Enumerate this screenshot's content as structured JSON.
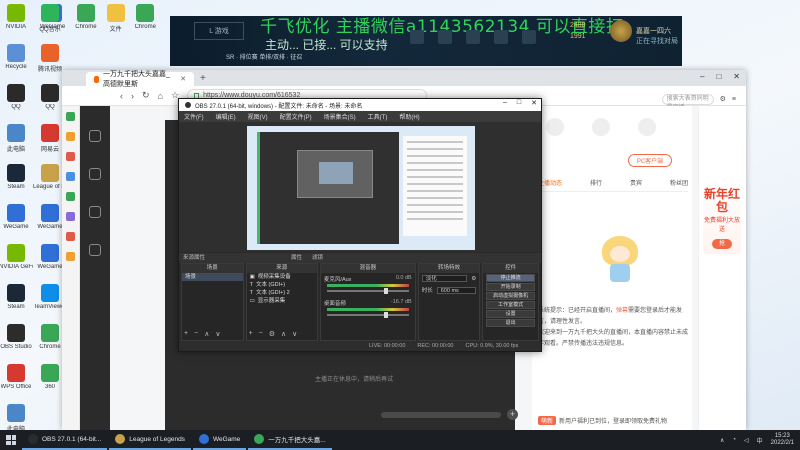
{
  "desktop": {
    "icons_left": [
      {
        "label": "NVIDIA",
        "icon": "nvidia-icon",
        "color": "#76b900"
      },
      {
        "label": "Recycle",
        "icon": "recycle-bin-icon",
        "color": "#5b8fd6"
      },
      {
        "label": "QQ",
        "icon": "qq-icon",
        "color": "#2a2a2a"
      },
      {
        "label": "此电脑",
        "icon": "computer-icon",
        "color": "#4b86c8"
      },
      {
        "label": "Steam",
        "icon": "steam-icon",
        "color": "#1b2838"
      },
      {
        "label": "WeGame",
        "icon": "wegame-icon",
        "color": "#2f6fd6"
      },
      {
        "label": "NVIDIA GeForce",
        "icon": "geforce-icon",
        "color": "#76b900"
      },
      {
        "label": "Steam",
        "icon": "steam-icon",
        "color": "#1b2838"
      },
      {
        "label": "OBS Studio",
        "icon": "obs-icon",
        "color": "#2c2c2c"
      },
      {
        "label": "WPS Office",
        "icon": "wps-icon",
        "color": "#d6392f"
      },
      {
        "label": "此电脑",
        "icon": "computer-icon",
        "color": "#4b86c8"
      }
    ],
    "icons_col2": [
      {
        "label": "QQ音乐",
        "icon": "music-icon",
        "color": "#2fb45c"
      },
      {
        "label": "腾讯视频",
        "icon": "video-icon",
        "color": "#e8622a"
      },
      {
        "label": "QQ",
        "icon": "qq-icon",
        "color": "#2a2a2a"
      },
      {
        "label": "网易云",
        "icon": "cloud-music-icon",
        "color": "#d6392f"
      },
      {
        "label": "League of Legends",
        "icon": "lol-icon",
        "color": "#c8a24a"
      },
      {
        "label": "WeGame",
        "icon": "wegame-icon",
        "color": "#2f6fd6"
      },
      {
        "label": "WeGame",
        "icon": "wegame-icon",
        "color": "#2f6fd6"
      },
      {
        "label": "TeamViewer",
        "icon": "teamviewer-icon",
        "color": "#0e8ee9"
      },
      {
        "label": "Chrome",
        "icon": "chrome-icon",
        "color": "#3aa757"
      },
      {
        "label": "360",
        "icon": "shield-icon",
        "color": "#3aa757"
      }
    ],
    "icons_top": [
      {
        "label": "WeGame",
        "color": "#2f6fd6"
      },
      {
        "label": "Chrome",
        "color": "#3aa757"
      },
      {
        "label": "文件",
        "color": "#f0c040"
      },
      {
        "label": "Chrome",
        "color": "#3aa757"
      }
    ]
  },
  "overlay": {
    "banner_text": "千飞优化 主播微信a1143562134 可以直接打",
    "sub_text": "主动... 已接... 可以支持",
    "game_tag": "L 游戏",
    "mode": "SR · 排位赛 单排/双排 · 征召",
    "points_1": "2480",
    "points_2": "1991",
    "rank_name": "嘉嘉一四六",
    "rank_status": "正在寻找对局"
  },
  "browser": {
    "tab_title": "一万九千把大头嘉嘉_高德默里斯",
    "url": "https://www.douyu.com/616532",
    "search_placeholder": "搜索大表哥同明星直播",
    "new_tab": "+",
    "window_controls": [
      "–",
      "□",
      "✕"
    ]
  },
  "stream_page": {
    "player_hint": "主播正在休息中，请稍后再试",
    "pc_button": "PC客户端",
    "tabs": [
      "主播动态",
      "排行",
      "贵宾",
      "粉丝团"
    ],
    "notice_1": "系统提示：已经开启直播间，",
    "notice_highlight": "弹幕",
    "notice_2": "需要您登录后才能发言，请理性发言。",
    "notice_3": "欢迎来到一万九千把大头的直播间，本直播内容禁止未成年观看。严禁传播违法违规信息。",
    "bottom_badge": "萌新",
    "bottom_text": "新用户福利已到位，登录即领取免费礼物",
    "ny_title": "新年红包",
    "ny_sub": "免费福利大放送",
    "ny_btn": "抢"
  },
  "obs": {
    "title": "OBS 27.0.1 (64-bit, windows) - 配置文件: 未命名 - 场景: 未命名",
    "menu": [
      "文件(F)",
      "编辑(E)",
      "视图(V)",
      "配置文件(P)",
      "场景集合(S)",
      "工具(T)",
      "帮助(H)"
    ],
    "strip_label": "来源属性",
    "strip_buttons": [
      "属性",
      "滤镜"
    ],
    "scenes_header": "场景",
    "scenes": [
      "场景"
    ],
    "sources_header": "来源",
    "sources": [
      "视频采集设备",
      "文本 (GDI+)",
      "文本 (GDI+) 2",
      "显示器采集"
    ],
    "mixer_header": "混音器",
    "mixer": [
      {
        "name": "麦克风/Aux",
        "db": "0.0 dB"
      },
      {
        "name": "桌面音频",
        "db": "-16.7 dB"
      }
    ],
    "transitions_header": "转场特效",
    "transition_type": "淡化",
    "duration_label": "时长",
    "duration_value": "600 ms",
    "controls_header": "控件",
    "controls": [
      "停止推流",
      "开始录制",
      "启动虚拟摄像机",
      "工作室模式",
      "设置",
      "退出"
    ],
    "status_live": "LIVE: 00:00:00",
    "status_rec": "REC: 00:00:00",
    "status_cpu": "CPU: 0.9%, 30.00 fps",
    "foot_buttons": [
      "+",
      "−",
      "∧",
      "∨"
    ]
  },
  "taskbar": {
    "items": [
      {
        "label": "OBS 27.0.1 (64-bit...",
        "color": "#2c2c2c"
      },
      {
        "label": "League of Legends",
        "color": "#c8a24a"
      },
      {
        "label": "WeGame",
        "color": "#2f6fd6"
      },
      {
        "label": "一万九千把大头嘉...",
        "color": "#3aa757"
      }
    ],
    "time": "15:23",
    "date": "2022/2/1",
    "tray_lang": "中"
  }
}
